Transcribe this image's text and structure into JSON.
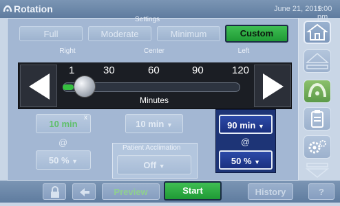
{
  "title": "Rotation",
  "date": "June 21, 2019",
  "time": "1:00 pm",
  "settings": {
    "label": "Settings",
    "options": [
      "Full",
      "Moderate",
      "Minimum",
      "Custom"
    ],
    "selected": "Custom"
  },
  "columns": {
    "right": "Right",
    "center": "Center",
    "left": "Left"
  },
  "slider": {
    "ticks": [
      "1",
      "30",
      "60",
      "90",
      "120"
    ],
    "unit_label": "Minutes",
    "value_minutes": 10
  },
  "right": {
    "duration": "10 min",
    "close": "x",
    "at": "@",
    "angle": "50 %"
  },
  "center": {
    "duration": "10 min"
  },
  "left": {
    "duration": "90 min",
    "at": "@",
    "angle": "50 %"
  },
  "patient_acclimation": {
    "label": "Patient Acclimation",
    "value": "Off"
  },
  "bottom": {
    "preview": "Preview",
    "start": "Start",
    "history": "History",
    "help": "?"
  },
  "colors": {
    "selected_green": "#2fae44",
    "active_blue": "#1d3476"
  }
}
